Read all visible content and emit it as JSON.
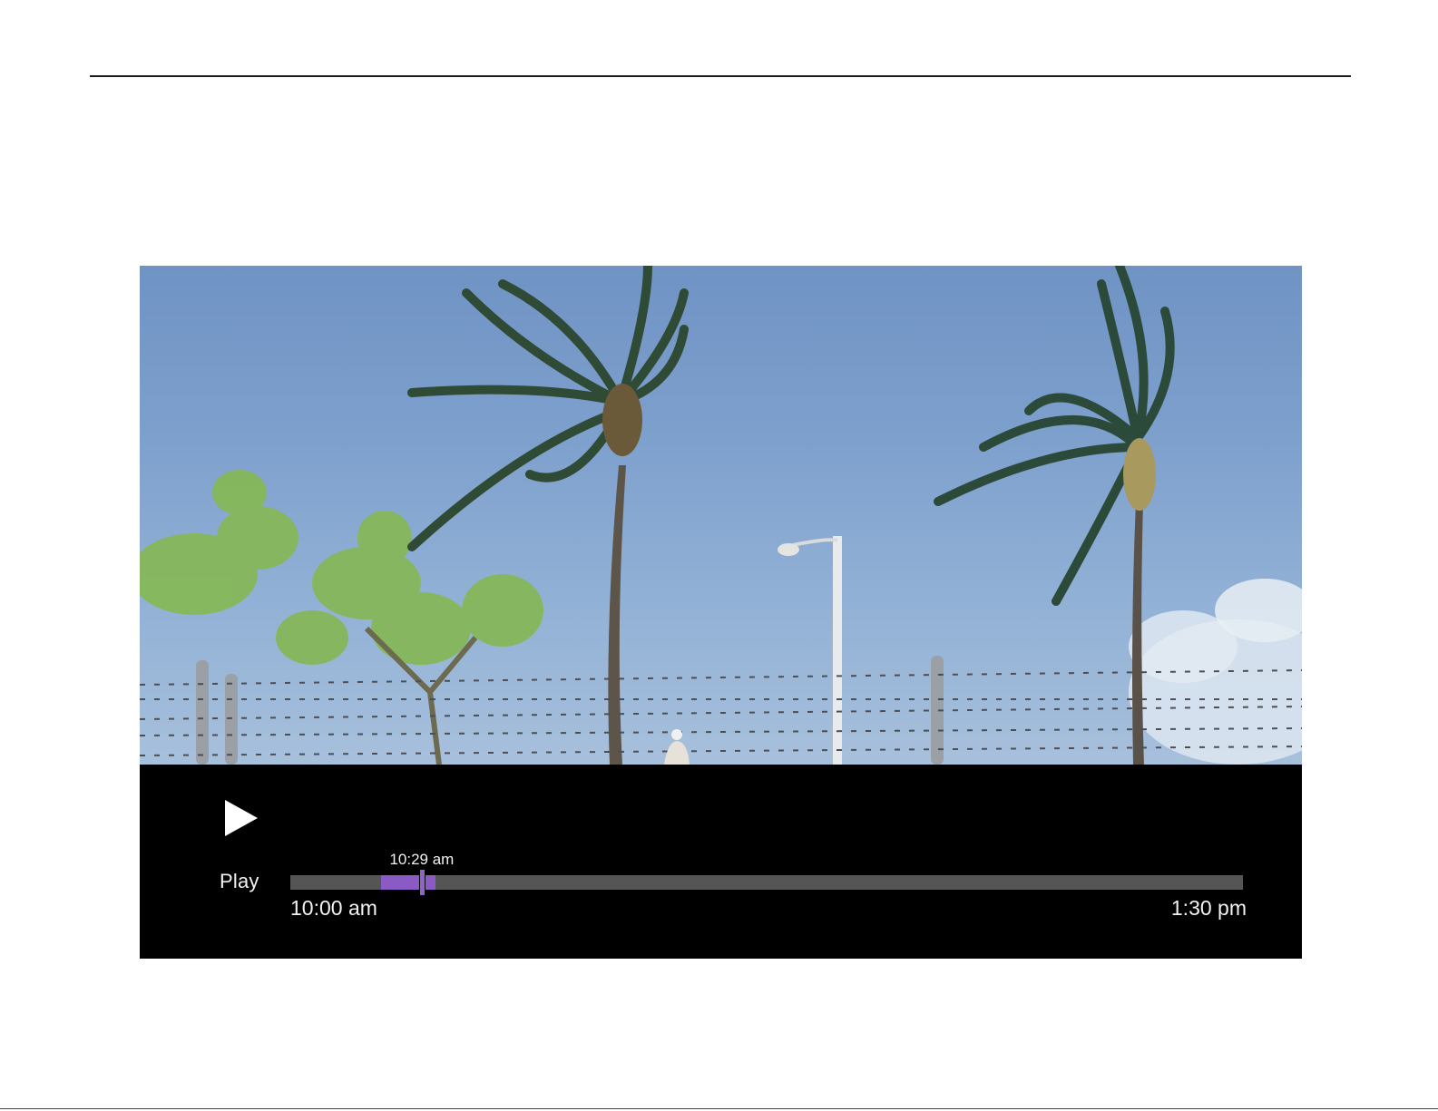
{
  "player": {
    "play_label": "Play",
    "start_time": "10:00 am",
    "end_time": "1:30 pm",
    "current_time": "10:29 am",
    "progress": {
      "buffered_start_fraction": 0.095,
      "buffered_end_fraction": 0.152,
      "playhead_fraction": 0.138
    },
    "accent_color": "#8a5bc4"
  },
  "icons": {
    "play": "play-icon"
  }
}
